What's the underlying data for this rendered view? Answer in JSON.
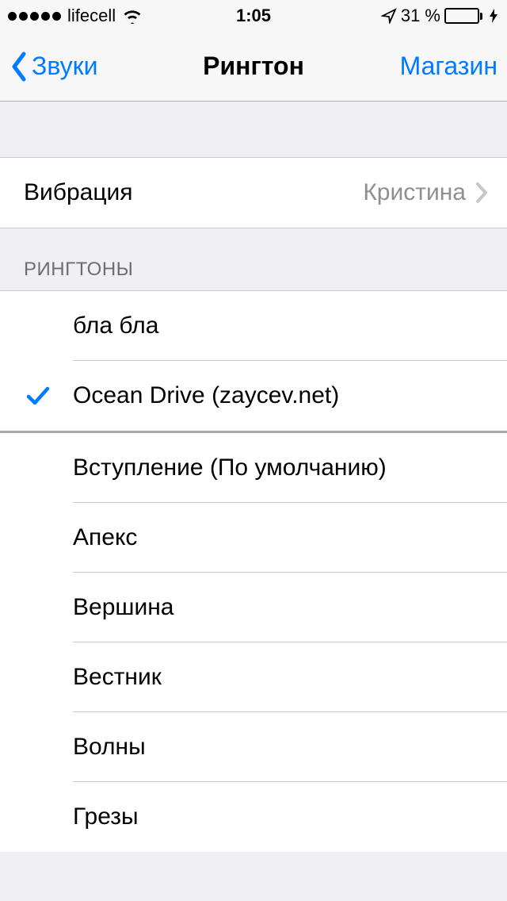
{
  "status": {
    "carrier": "lifecell",
    "time": "1:05",
    "battery_pct": "31 %"
  },
  "nav": {
    "back_label": "Звуки",
    "title": "Рингтон",
    "action_label": "Магазин"
  },
  "vibration": {
    "label": "Вибрация",
    "value": "Кристина"
  },
  "sections": {
    "custom_header": "РИНГТОНЫ",
    "custom_items": [
      {
        "label": "бла бла",
        "selected": false
      },
      {
        "label": "Ocean Drive (zaycev.net)",
        "selected": true
      }
    ],
    "builtin_items": [
      {
        "label": "Вступление (По умолчанию)"
      },
      {
        "label": "Апекс"
      },
      {
        "label": "Вершина"
      },
      {
        "label": "Вестник"
      },
      {
        "label": "Волны"
      },
      {
        "label": "Грезы"
      }
    ]
  },
  "colors": {
    "tint": "#007aff",
    "battery_fill": "#ffcc00"
  }
}
